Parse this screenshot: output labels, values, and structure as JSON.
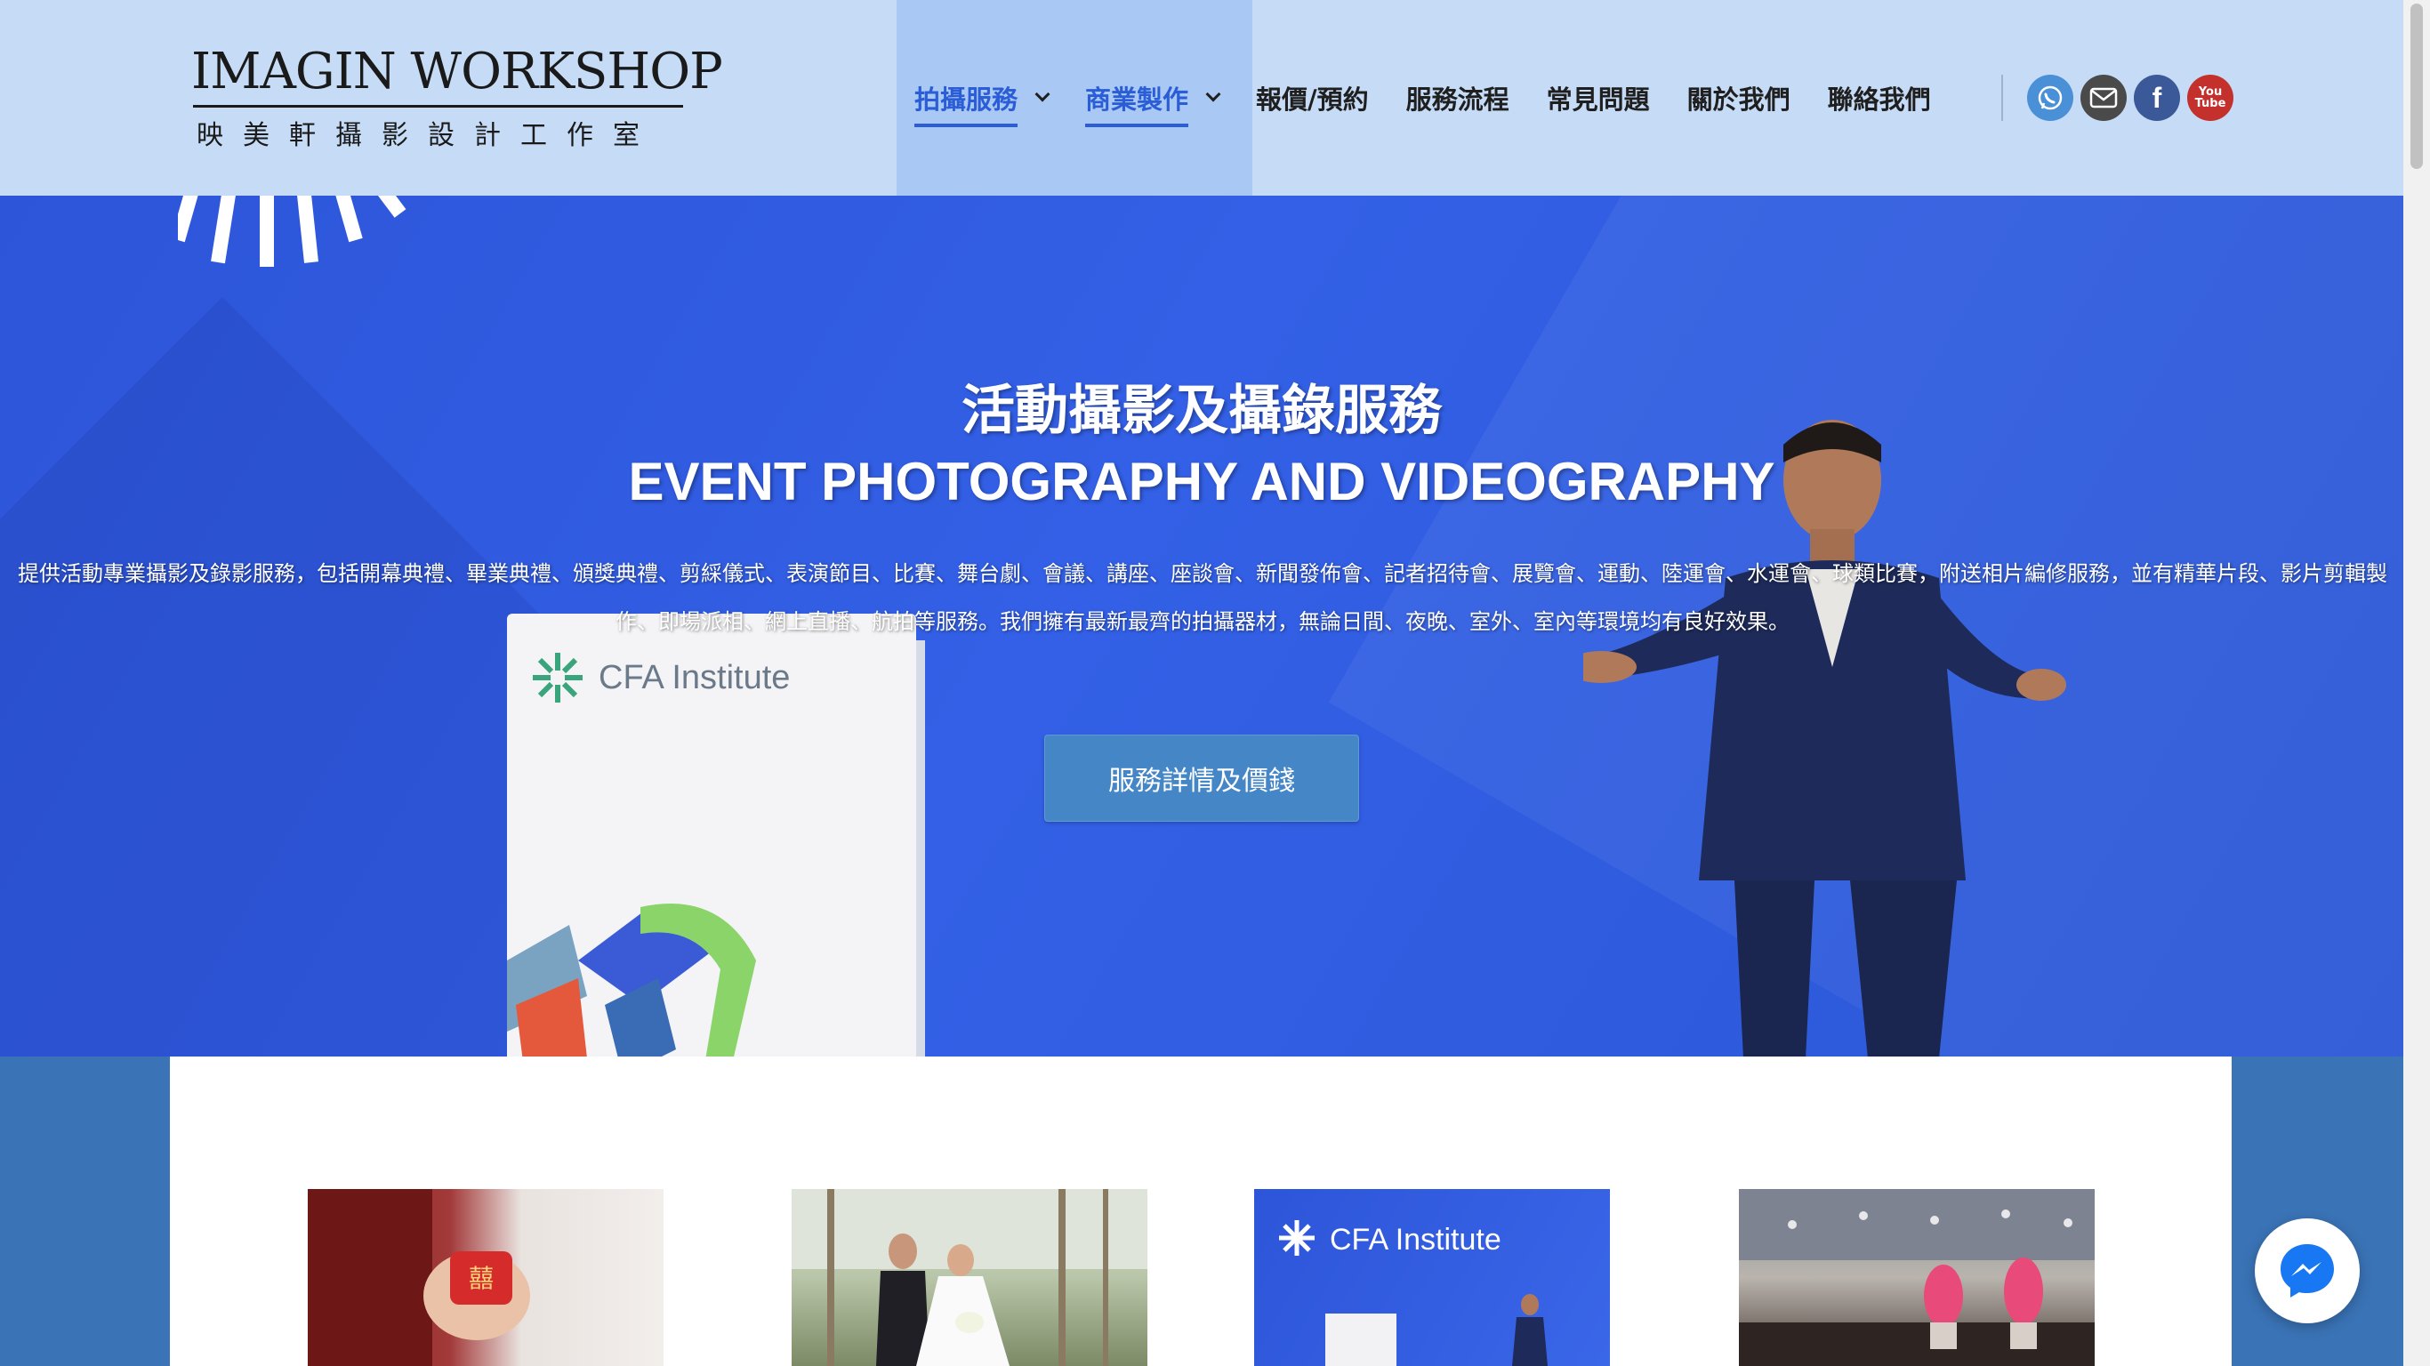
{
  "brand": {
    "logo_main": "IMAGIN WORKSHOP",
    "logo_sub": "映美軒攝影設計工作室"
  },
  "nav": {
    "items": [
      {
        "label": "拍攝服務",
        "active": true,
        "dropdown": true
      },
      {
        "label": "商業製作",
        "active": true,
        "dropdown": true
      },
      {
        "label": "報價/預約",
        "active": false,
        "dropdown": false
      },
      {
        "label": "服務流程",
        "active": false,
        "dropdown": false
      },
      {
        "label": "常見問題",
        "active": false,
        "dropdown": false
      },
      {
        "label": "關於我們",
        "active": false,
        "dropdown": false
      },
      {
        "label": "聯絡我們",
        "active": false,
        "dropdown": false
      }
    ],
    "active_color": "#2b5ed6"
  },
  "social": {
    "icons": [
      "whatsapp-icon",
      "email-icon",
      "facebook-icon",
      "youtube-icon"
    ],
    "youtube_text_1": "You",
    "youtube_text_2": "Tube"
  },
  "hero": {
    "title_zh": "活動攝影及攝錄服務",
    "title_en": "EVENT PHOTOGRAPHY AND VIDEOGRAPHY",
    "description": "提供活動專業攝影及錄影服務，包括開幕典禮、畢業典禮、頒獎典禮、剪綵儀式、表演節目、比賽、舞台劇、會議、講座、座談會、新聞發佈會、記者招待會、展覽會、運動、陸運會、水運會、球類比賽，附送相片編修服務，並有精華片段、影片剪輯製作、即場派相、網上直播、航拍等服務。我們擁有最新最齊的拍攝器材，無論日間、夜晚、室外、室內等環境均有良好效果。",
    "cta_label": "服務詳情及價錢",
    "podium_logo_text": "CFA Institute",
    "background_color": "#3360e6"
  },
  "gallery": {
    "thumb3_text": "CFA Institute"
  },
  "colors": {
    "header_bg": "#c6dcf6",
    "nav_active_bg": "#a9c8f4",
    "page_bg": "#3a73b6",
    "cta_bg": "#4586c7"
  }
}
